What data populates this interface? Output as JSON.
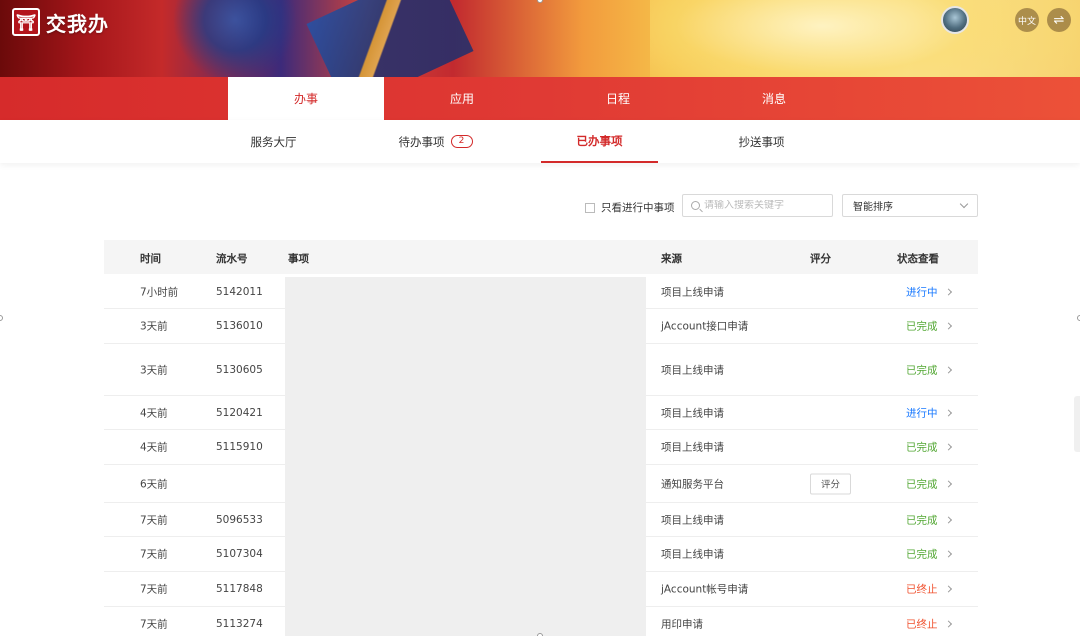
{
  "header": {
    "logo_text": "交我办",
    "lang_label": "中文",
    "switch_icon": "⇌"
  },
  "main_tabs": [
    {
      "label": "办事",
      "active": true
    },
    {
      "label": "应用",
      "active": false
    },
    {
      "label": "日程",
      "active": false
    },
    {
      "label": "消息",
      "active": false
    }
  ],
  "sub_tabs": [
    {
      "label": "服务大厅",
      "active": false
    },
    {
      "label": "待办事项",
      "badge": "2",
      "active": false
    },
    {
      "label": "已办事项",
      "active": true
    },
    {
      "label": "抄送事项",
      "active": false
    }
  ],
  "filter": {
    "only_in_progress_label": "只看进行中事项",
    "search_placeholder": "请输入搜索关键字",
    "sort_label": "智能排序"
  },
  "table": {
    "columns": [
      "时间",
      "流水号",
      "事项",
      "来源",
      "评分",
      "状态查看"
    ],
    "rows": [
      {
        "time": "7小时前",
        "serial": "5142011",
        "source": "项目上线申请",
        "rating": "",
        "status": "进行中",
        "status_color": "#1677ff"
      },
      {
        "time": "3天前",
        "serial": "5136010",
        "source": "jAccount接口申请",
        "rating": "",
        "status": "已完成",
        "status_color": "#52a733"
      },
      {
        "time": "3天前",
        "serial": "5130605",
        "source": "项目上线申请",
        "rating": "",
        "status": "已完成",
        "status_color": "#52a733"
      },
      {
        "time": "4天前",
        "serial": "5120421",
        "source": "项目上线申请",
        "rating": "",
        "status": "进行中",
        "status_color": "#1677ff"
      },
      {
        "time": "4天前",
        "serial": "5115910",
        "source": "项目上线申请",
        "rating": "",
        "status": "已完成",
        "status_color": "#52a733"
      },
      {
        "time": "6天前",
        "serial": "",
        "source": "通知服务平台",
        "rating": "评分",
        "status": "已完成",
        "status_color": "#52a733"
      },
      {
        "time": "7天前",
        "serial": "5096533",
        "source": "项目上线申请",
        "rating": "",
        "status": "已完成",
        "status_color": "#52a733"
      },
      {
        "time": "7天前",
        "serial": "5107304",
        "source": "项目上线申请",
        "rating": "",
        "status": "已完成",
        "status_color": "#52a733"
      },
      {
        "time": "7天前",
        "serial": "5117848",
        "source": "jAccount帐号申请",
        "rating": "",
        "status": "已终止",
        "status_color": "#f0502d"
      },
      {
        "time": "7天前",
        "serial": "5113274",
        "source": "用印申请",
        "rating": "",
        "status": "已终止",
        "status_color": "#f0502d"
      }
    ]
  }
}
